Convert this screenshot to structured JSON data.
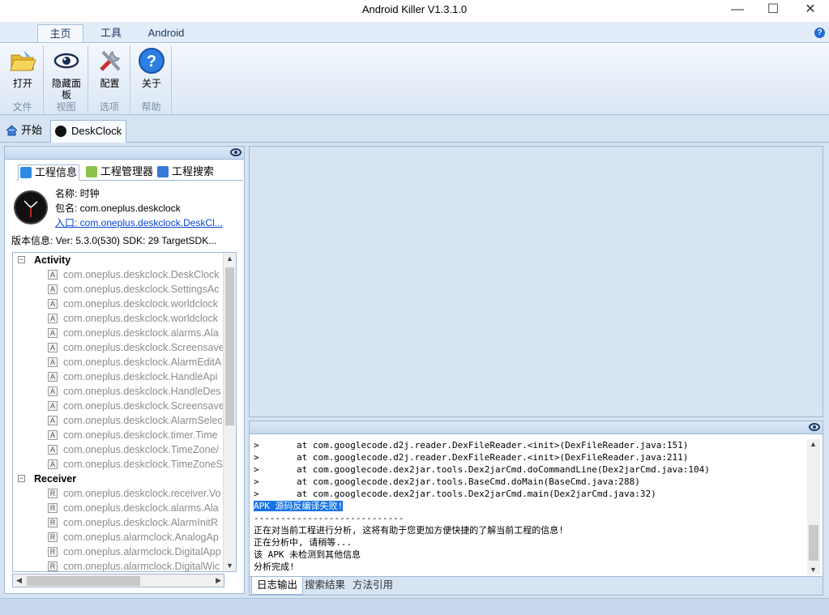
{
  "window": {
    "title": "Android Killer V1.3.1.0",
    "min": "—",
    "max": "☐",
    "close": "✕"
  },
  "ribbon_tabs": [
    "主页",
    "工具",
    "Android"
  ],
  "ribbon": {
    "buttons": [
      {
        "label": "打开",
        "group": "文件"
      },
      {
        "label": "隐藏面\n板",
        "group": "视图"
      },
      {
        "label": "配置",
        "group": "选项"
      },
      {
        "label": "关于",
        "group": "帮助"
      }
    ],
    "groups": [
      "文件",
      "视图",
      "选项",
      "帮助"
    ]
  },
  "doc_tabs": [
    "开始",
    "DeskClock"
  ],
  "project_tabs": [
    "工程信息",
    "工程管理器",
    "工程搜索"
  ],
  "app_info": {
    "name": "名称: 时钟",
    "package": "包名: com.oneplus.deskclock",
    "entry": "入口: com.oneplus.deskclock.DeskCl...",
    "version": "版本信息: Ver: 5.3.0(530) SDK: 29 TargetSDK..."
  },
  "tree": {
    "activity_label": "Activity",
    "activities": [
      "com.oneplus.deskclock.DeskClock",
      "com.oneplus.deskclock.SettingsAc",
      "com.oneplus.deskclock.worldclock",
      "com.oneplus.deskclock.worldclock",
      "com.oneplus.deskclock.alarms.Ala",
      "com.oneplus.deskclock.Screensave",
      "com.oneplus.deskclock.AlarmEditA",
      "com.oneplus.deskclock.HandleApi",
      "com.oneplus.deskclock.HandleDes",
      "com.oneplus.deskclock.Screensave",
      "com.oneplus.deskclock.AlarmSelec",
      "com.oneplus.deskclock.timer.Time",
      "com.oneplus.deskclock.TimeZone/",
      "com.oneplus.deskclock.TimeZoneS"
    ],
    "receiver_label": "Receiver",
    "receivers": [
      "com.oneplus.deskclock.receiver.Vo",
      "com.oneplus.deskclock.alarms.Ala",
      "com.oneplus.deskclock.AlarmInitR",
      "com.oneplus.alarmclock.AnalogAp",
      "com.oneplus.alarmclock.DigitalApp",
      "com.oneplus.alarmclock.DigitalWic"
    ]
  },
  "log": [
    ">       at com.googlecode.d2j.reader.DexFileReader.<init>(DexFileReader.java:151)",
    ">       at com.googlecode.d2j.reader.DexFileReader.<init>(DexFileReader.java:211)",
    ">       at com.googlecode.dex2jar.tools.Dex2jarCmd.doCommandLine(Dex2jarCmd.java:104)",
    ">       at com.googlecode.dex2jar.tools.BaseCmd.doMain(BaseCmd.java:288)",
    ">       at com.googlecode.dex2jar.tools.Dex2jarCmd.main(Dex2jarCmd.java:32)",
    "APK 源码反编译失败!",
    "----------------------------",
    "正在对当前工程进行分析, 这将有助于您更加方便快捷的了解当前工程的信息!",
    "正在分析中, 请稍等...",
    "该 APK 未检测到其他信息",
    "分析完成!"
  ],
  "bottom_tabs": [
    "日志输出",
    "搜索结果",
    "方法引用"
  ]
}
